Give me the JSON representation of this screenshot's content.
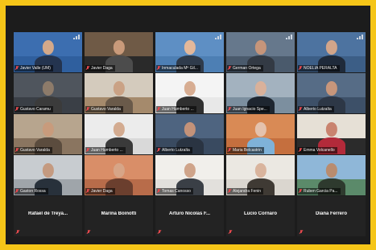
{
  "colors": {
    "frame": "#f5c518",
    "background": "#1c1c1c",
    "active_outline": "#c9e26a",
    "muted_mic": "#e5484d"
  },
  "participants": [
    {
      "name": "Javier Valle (UM)",
      "video": true,
      "active": true,
      "bg": "#2f5f9e",
      "wall": "#3c6eb0",
      "skin": "#d4a98a",
      "shirt": "#24344f",
      "signal": true
    },
    {
      "name": "Javier Daga",
      "video": true,
      "bg": "#2a2a2a",
      "wall": "#6f5a46",
      "skin": "#c99a7a",
      "shirt": "#4c4c4c",
      "signal": false
    },
    {
      "name": "Inmaculada Mª Gil...",
      "video": true,
      "bg": "#4d7fb4",
      "wall": "#5e8fc4",
      "skin": "#e3b89a",
      "shirt": "#2f3b4b",
      "signal": true
    },
    {
      "name": "German Ortega",
      "video": true,
      "bg": "#4a5a6c",
      "wall": "#66788c",
      "skin": "#c6957a",
      "shirt": "#333a44",
      "signal": true
    },
    {
      "name": "NOELIA PERALTA",
      "video": true,
      "bg": "#3c5e86",
      "wall": "#4d73a0",
      "skin": "#d2a58a",
      "shirt": "#1f2a3a",
      "signal": true
    },
    {
      "name": "Gustavo Caramu",
      "video": true,
      "bg": "#3a3f46",
      "wall": "#4f555d",
      "skin": "#8d7b6a",
      "shirt": "#3b3b3b",
      "signal": false
    },
    {
      "name": "Gustavo Varalda",
      "video": true,
      "bg": "#a58a6c",
      "wall": "#d4cbbd",
      "skin": "#caa285",
      "shirt": "#6a5a4a",
      "signal": false
    },
    {
      "name": "Juan Humberto ...",
      "video": true,
      "bg": "#e8e8e8",
      "wall": "#f4f4f4",
      "skin": "#d7ad92",
      "shirt": "#2f2f2f",
      "signal": false
    },
    {
      "name": "Juan Ignacio Spe...",
      "video": true,
      "bg": "#7c8f9f",
      "wall": "#a3b2bf",
      "skin": "#d9b19a",
      "shirt": "#1e2630",
      "signal": false
    },
    {
      "name": "Alberto Lutzalta",
      "video": true,
      "bg": "#3d5068",
      "wall": "#566c86",
      "skin": "#c7967b",
      "shirt": "#2d3746",
      "signal": false
    },
    {
      "name": "Gustavo Varalda",
      "video": true,
      "bg": "#8a7560",
      "wall": "#b7a58e",
      "skin": "#c89b7c",
      "shirt": "#5b4c3e",
      "signal": false
    },
    {
      "name": "Juan Humberto ...",
      "video": true,
      "bg": "#d9d9d9",
      "wall": "#ececec",
      "skin": "#d3ab90",
      "shirt": "#3a3a3a",
      "signal": false
    },
    {
      "name": "Alberto Lutzalta",
      "video": true,
      "bg": "#394a60",
      "wall": "#4e6480",
      "skin": "#c39279",
      "shirt": "#2a3442",
      "signal": false
    },
    {
      "name": "Maria Belcastrin",
      "video": true,
      "bg": "#c56f3e",
      "wall": "#d98a55",
      "skin": "#e4c2ad",
      "shirt": "#7fb2d8",
      "signal": false
    },
    {
      "name": "Emma Volcanello",
      "video": true,
      "bg": "#2b2b2b",
      "wall": "#e6e0d6",
      "skin": "#c9836f",
      "shirt": "#b22a3a",
      "signal": false
    },
    {
      "name": "Gaston Rossa",
      "video": true,
      "bg": "#9fa5aa",
      "wall": "#c8ccd0",
      "skin": "#c49a80",
      "shirt": "#28313b",
      "signal": false
    },
    {
      "name": "Javier Daga",
      "video": true,
      "bg": "#b86c4a",
      "wall": "#d98e68",
      "skin": "#d7a587",
      "shirt": "#6b3f2e",
      "signal": false
    },
    {
      "name": "Tomas Canosso",
      "video": true,
      "bg": "#e2e0dc",
      "wall": "#f1efeb",
      "skin": "#cfa48a",
      "shirt": "#3a3f46",
      "signal": false
    },
    {
      "name": "Alejandra Fenin",
      "video": true,
      "bg": "#dad6cf",
      "wall": "#ebe8e2",
      "skin": "#d9b49d",
      "shirt": "#3f3a34",
      "signal": false
    },
    {
      "name": "Ruben Garcia Pa...",
      "video": true,
      "bg": "#5b8a6a",
      "wall": "#8fb7d8",
      "skin": "#b98c6f",
      "shirt": "#2e3a2e",
      "signal": false
    },
    {
      "name": "Rafael de Treya...",
      "video": false
    },
    {
      "name": "Marina Boinotti",
      "video": false
    },
    {
      "name": "Arturo Nicolas F...",
      "video": false
    },
    {
      "name": "Lucio Cornaro",
      "video": false
    },
    {
      "name": "Diana Ferrero",
      "video": false
    }
  ]
}
